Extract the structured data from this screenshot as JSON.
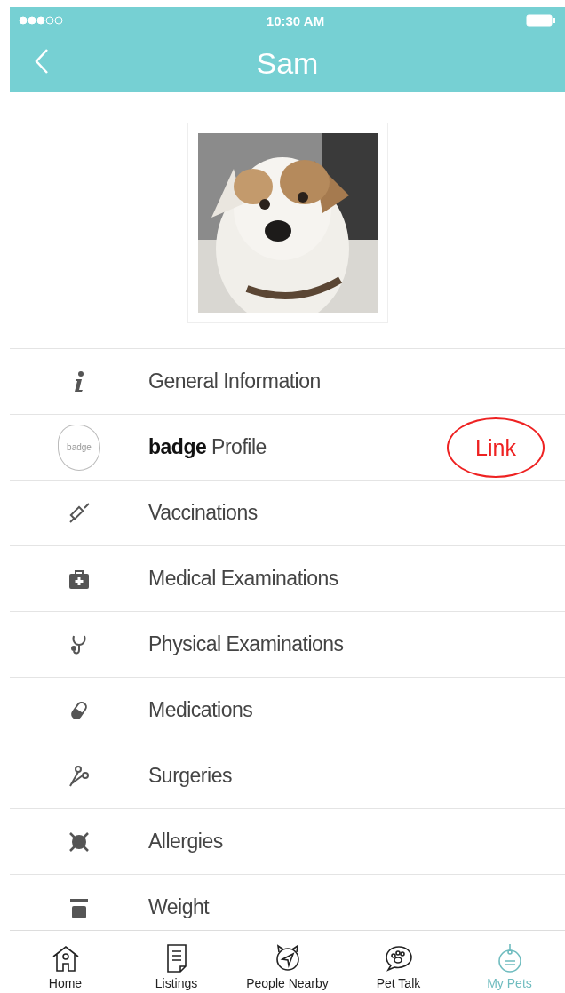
{
  "status_bar": {
    "time": "10:30 AM"
  },
  "header": {
    "title": "Sam"
  },
  "menu": [
    {
      "kind": "info",
      "label": "General Information"
    },
    {
      "kind": "badge",
      "label": "**badge** Profile",
      "icon_text": "badge",
      "annotation": "Link"
    },
    {
      "kind": "syringe",
      "label": "Vaccinations"
    },
    {
      "kind": "kit",
      "label": "Medical Examinations"
    },
    {
      "kind": "stethoscope",
      "label": "Physical Examinations"
    },
    {
      "kind": "pill",
      "label": "Medications"
    },
    {
      "kind": "scissors",
      "label": "Surgeries"
    },
    {
      "kind": "allergy",
      "label": "Allergies"
    },
    {
      "kind": "scale",
      "label": "Weight"
    }
  ],
  "tabs": [
    {
      "kind": "home",
      "label": "Home",
      "selected": false
    },
    {
      "kind": "listings",
      "label": "Listings",
      "selected": false
    },
    {
      "kind": "nearby",
      "label": "People Nearby",
      "selected": false
    },
    {
      "kind": "talk",
      "label": "Pet Talk",
      "selected": false
    },
    {
      "kind": "pets",
      "label": "My Pets",
      "selected": true
    }
  ]
}
